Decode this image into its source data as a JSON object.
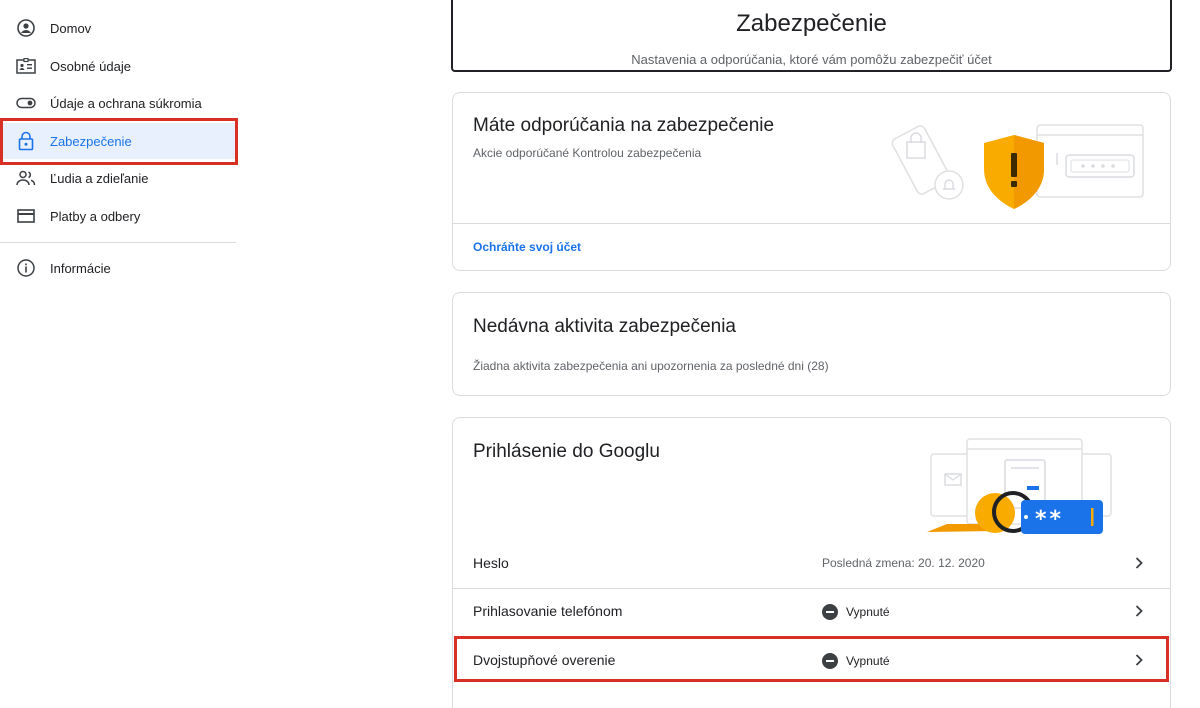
{
  "sidebar": {
    "items": [
      {
        "label": "Domov",
        "icon": "account-circle-icon"
      },
      {
        "label": "Osobné údaje",
        "icon": "id-card-icon"
      },
      {
        "label": "Údaje a ochrana súkromia",
        "icon": "toggle-icon"
      },
      {
        "label": "Zabezpečenie",
        "icon": "lock-icon",
        "active": true
      },
      {
        "label": "Ľudia a zdieľanie",
        "icon": "people-icon"
      },
      {
        "label": "Platby a odbery",
        "icon": "credit-card-icon"
      },
      {
        "label": "Informácie",
        "icon": "info-icon"
      }
    ]
  },
  "header": {
    "title": "Zabezpečenie",
    "subtitle": "Nastavenia a odporúčania, ktoré vám pomôžu zabezpečiť účet"
  },
  "recommendations": {
    "title": "Máte odporúčania na zabezpečenie",
    "description": "Akcie odporúčané Kontrolou zabezpečenia",
    "link": "Ochráňte svoj účet"
  },
  "recent_activity": {
    "title": "Nedávna aktivita zabezpečenia",
    "description": "Žiadna aktivita zabezpečenia ani upozornenia za posledné dni (28)"
  },
  "signin": {
    "title": "Prihlásenie do Googlu",
    "rows": [
      {
        "label": "Heslo",
        "value": "Posledná zmena: 20. 12. 2020",
        "status": null
      },
      {
        "label": "Prihlasovanie telefónom",
        "value": "Vypnuté",
        "status": "off"
      },
      {
        "label": "Dvojstupňové overenie",
        "value": "Vypnuté",
        "status": "off"
      }
    ],
    "password_mask": "**"
  },
  "colors": {
    "accent": "#1a73e8",
    "active_bg": "#e8f0fe",
    "highlight": "#d93025",
    "shield": "#f9ab00"
  }
}
